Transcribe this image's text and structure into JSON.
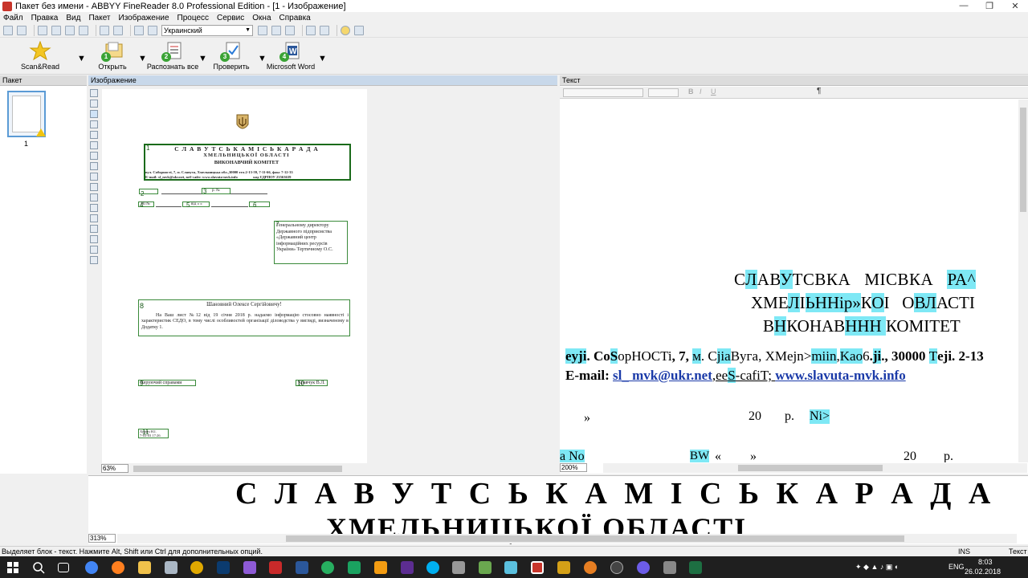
{
  "window": {
    "title": "Пакет без имени - ABBYY FineReader 8.0 Professional Edition - [1 - Изображение]",
    "min": "—",
    "restore": "❐",
    "close": "✕"
  },
  "menu": [
    "Файл",
    "Правка",
    "Вид",
    "Пакет",
    "Изображение",
    "Процесс",
    "Сервис",
    "Окна",
    "Справка"
  ],
  "toolbar": {
    "language": "Украинский"
  },
  "big_buttons": [
    {
      "label": "Scan&Read",
      "icon": "star-wand-icon"
    },
    {
      "label": "Открыть",
      "icon": "open-folder-icon",
      "step": "1"
    },
    {
      "label": "Распознать все",
      "icon": "recognize-icon",
      "step": "2"
    },
    {
      "label": "Проверить",
      "icon": "check-icon",
      "step": "3"
    },
    {
      "label": "Microsoft Word",
      "icon": "word-icon",
      "step": "4"
    }
  ],
  "panes": {
    "batch": {
      "title": "Пакет",
      "page_number": "1"
    },
    "image": {
      "title": "Изображение",
      "zoom": "63%"
    },
    "text": {
      "title": "Текст",
      "zoom": "200%"
    },
    "zoom": {
      "zoom": "313%"
    }
  },
  "image_page": {
    "line1": "С Л А В У Т С Ь К А   М І С Ь К А   Р А Д А",
    "line2": "ХМЕЛЬНИЦЬКОЇ   ОБЛАСТІ",
    "line3": "ВИКОНАВЧИЙ КОМІТЕТ",
    "addr1": "вул. Соборності, 7, м. Славута, Хмельницька обл.,30000 тел.2-13-59, 7-11-66, факс 7-12-33",
    "addr2": "E-mail: sl_mvk@ukr.net, веб-сайт: www.slavuta-mvk.info                 код ЄДРПОУ 23563639",
    "addressee": "Генеральному директору Державного підприємства «Державний центр інформаційних ресурсів України» Тертичному О.С.",
    "salutation": "Шановний Олексе Сергійовичу!",
    "body": "На Ваш лист №12 від 19 січня 2018 р. надаємо інформацію стосовно наявності і характеристик СЕДО, в тому числі особливостей організації діловодства у вигляді, визначеному в Додатку 1.",
    "signature_left": "Керуючий справами",
    "signature_right": "Кравчук В.Л.",
    "executor": "Хомич Н.І.\n7-03-03 17:26",
    "block_numbers": [
      "1",
      "2",
      "3",
      "4",
      "5",
      "6",
      "7",
      "8",
      "9",
      "10",
      "11"
    ],
    "form_no": "Ні №",
    "form_date": "р.    №",
    "form_date2": "від «   »"
  },
  "text_doc": {
    "h1_a": "С",
    "h1_b": "Л",
    "h1_c": "АВ",
    "h1_d": "У",
    "h1_e": "ТСВКА   МІСВКА   ",
    "h1_f": "РА^",
    "h2_a": "ХМЕ",
    "h2_b": "Л",
    "h2_c": "І",
    "h2_d": "ЬН",
    "h2_e": "Нір»",
    "h2_f": "К",
    "h2_g": "О",
    "h2_h": "І   О",
    "h2_i": "ВЛ",
    "h2_j": "АСТІ",
    "h3_a": "В",
    "h3_b": "Н",
    "h3_c": "КОНАВ",
    "h3_d": "ННН ",
    "h3_e": "КОМІТЕТ",
    "addr_a": "eуji",
    "addr_b": ". Co",
    "addr_c": "S",
    "addr_d": "opHOCTi",
    "addr_e": ", 7, ",
    "addr_f": "м",
    "addr_g": ". C",
    "addr_h": "jia",
    "addr_i": "Bу",
    "addr_j": "гa, XMejn>",
    "addr_k": "miin",
    "addr_l": ",",
    "addr_m": "Kao",
    "addr_n": "6",
    "addr_o": ".",
    "addr_p": "ji",
    "addr_q": "., 30000 ",
    "addr_r": "T",
    "addr_s": "eji",
    "addr_t": ". 2-13",
    "email_label": "E-mail: ",
    "email_link": "sl_ mvk@ukr.net",
    "email_mid": ",ee",
    "email_s": "S",
    "email_rest": "-cafiT; ",
    "site_link": "www.slavuta-mvk.info",
    "row1_quote": "»",
    "row1_year": "20",
    "row1_r": "р.",
    "row1_no": "Ni>",
    "row2_a": "a No",
    "row2_bw": "BW",
    "row2_q1": "«",
    "row2_q2": "»",
    "row2_year": "20",
    "row2_r": "р."
  },
  "zoom_view": {
    "line1": "С Л А В У Т С Ь К А   М І С Ь К А   Р А Д А",
    "line2": "ХМЕЛЬНИЦЬКОЇ   ОБЛАСТІ"
  },
  "status": {
    "hint": "Выделяет блок - текст. Нажмите Alt, Shift или Ctrl для дополнительных опций.",
    "ins": "INS",
    "mode": "Текст"
  },
  "taskbar": {
    "lang": "ENG",
    "time": "8:03",
    "date": "26.02.2018"
  },
  "colors": {
    "highlight": "#7ee8f5",
    "block_border": "#3a8a3a",
    "link": "#1a3aa8"
  }
}
